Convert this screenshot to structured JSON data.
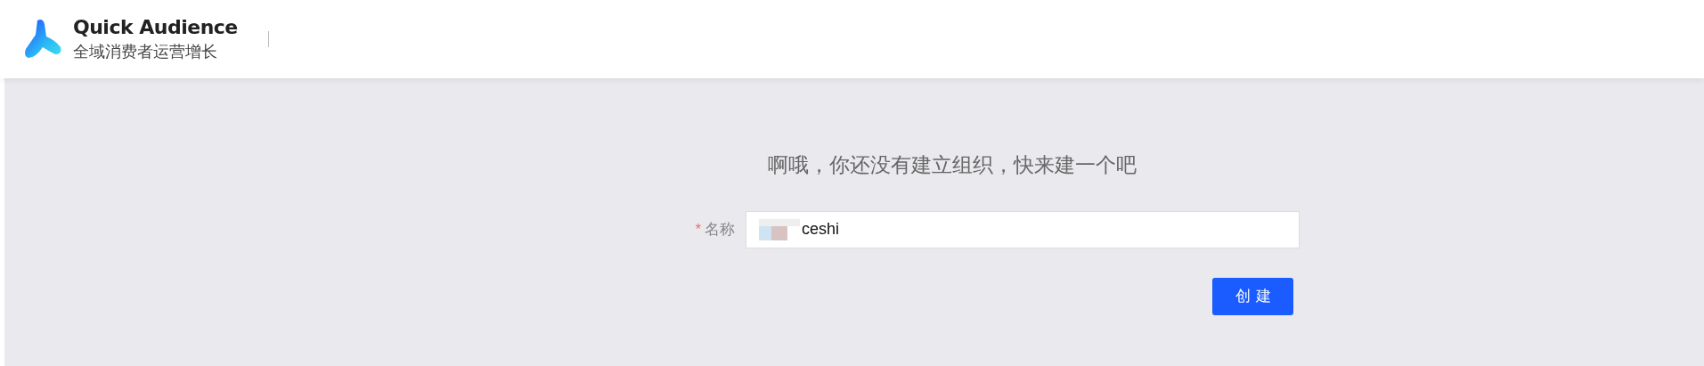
{
  "header": {
    "title": "Quick Audience",
    "subtitle": "全域消费者运营增长"
  },
  "main": {
    "heading": "啊哦，你还没有建立组织，快来建一个吧",
    "form": {
      "label": "名称",
      "required_mark": "*",
      "value": "ceshi",
      "value_redacted_prefix": true
    },
    "submit_button": "创建"
  }
}
